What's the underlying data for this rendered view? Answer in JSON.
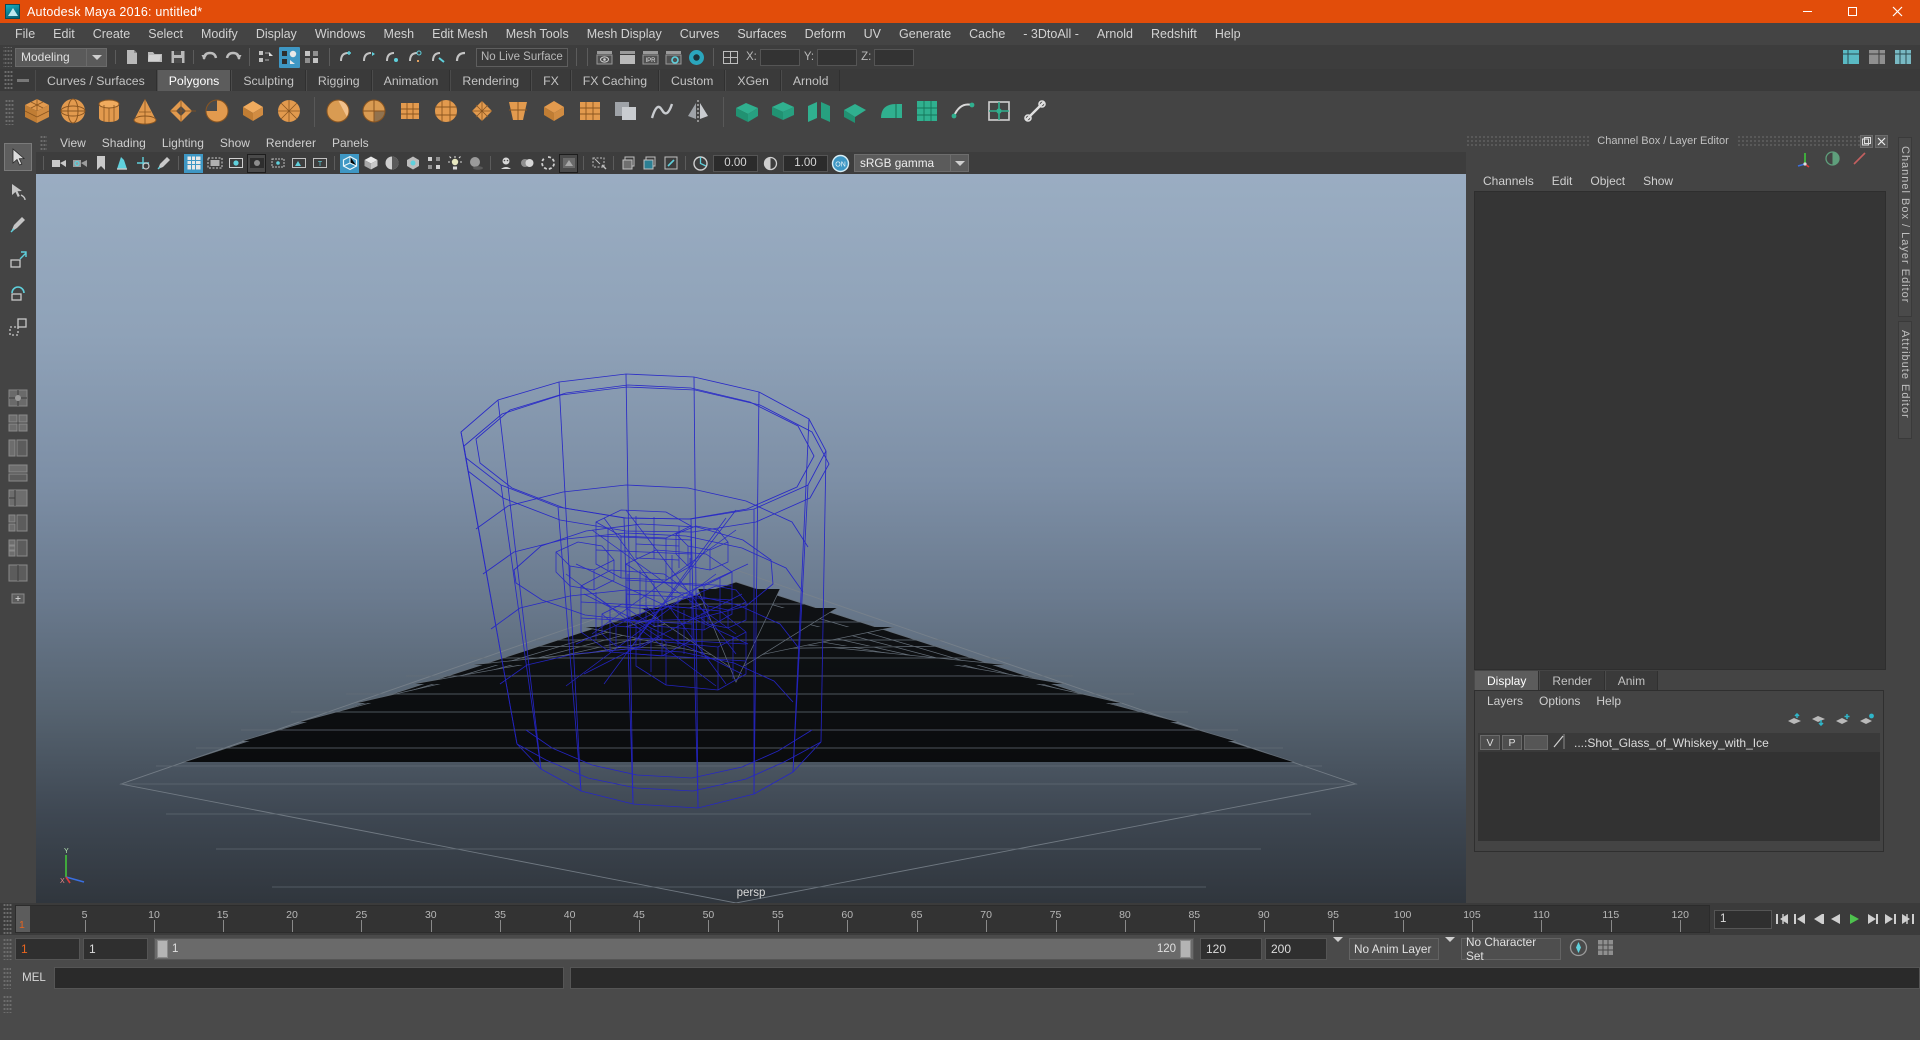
{
  "window": {
    "title": "Autodesk Maya 2016: untitled*",
    "app_icon": "maya-logo-icon",
    "minimize_label": "Minimize",
    "maximize_label": "Maximize",
    "close_label": "Close",
    "accent_color": "#e24d0a"
  },
  "menubar": {
    "items": [
      "File",
      "Edit",
      "Create",
      "Select",
      "Modify",
      "Display",
      "Windows",
      "Mesh",
      "Edit Mesh",
      "Mesh Tools",
      "Mesh Display",
      "Curves",
      "Surfaces",
      "Deform",
      "UV",
      "Generate",
      "Cache",
      "- 3DtoAll -",
      "Arnold",
      "Redshift",
      "Help"
    ]
  },
  "statusline": {
    "mode": "Modeling",
    "live_surface": "No Live Surface",
    "coord_x_label": "X:",
    "coord_y_label": "Y:",
    "coord_z_label": "Z:",
    "coord_x_value": "",
    "coord_y_value": "",
    "coord_z_value": "",
    "icons": [
      "new-scene-icon",
      "open-scene-icon",
      "save-scene-icon",
      "undo-icon",
      "redo-icon",
      "select-by-hierarchy-icon",
      "select-by-object-icon",
      "select-by-component-icon",
      "snap-to-grid-icon",
      "snap-to-curve-icon",
      "snap-to-point-icon",
      "snap-to-projected-center-icon",
      "snap-to-view-plane-icon",
      "make-live-icon",
      "show-render-view-icon",
      "render-current-frame-icon",
      "ipr-render-icon",
      "render-settings-icon",
      "hypershade-icon",
      "editor-layout-icon",
      "show-channel-box-icon",
      "show-attribute-editor-icon",
      "show-tool-settings-icon"
    ]
  },
  "shelf": {
    "tabs": [
      "Curves / Surfaces",
      "Polygons",
      "Sculpting",
      "Rigging",
      "Animation",
      "Rendering",
      "FX",
      "FX Caching",
      "Custom",
      "XGen",
      "Arnold"
    ],
    "active_tab": "Polygons",
    "icons": [
      "poly-cube-icon",
      "poly-sphere-icon",
      "poly-cylinder-icon",
      "poly-cone-icon",
      "poly-torus-icon",
      "poly-plane-icon",
      "poly-disc-icon",
      "poly-platonic-icon",
      "poly-pyramid-icon",
      "poly-prism-icon",
      "poly-pipe-icon",
      "poly-helix-icon",
      "poly-soccer-ball-icon",
      "poly-super-ellipse-icon",
      "combine-icon",
      "separate-icon",
      "booleans-icon",
      "smooth-icon",
      "mirror-geometry-icon",
      "extrude-icon",
      "bevel-icon",
      "bridge-icon",
      "append-polygon-icon",
      "wedge-icon",
      "sculpt-geometry-icon",
      "uv-editor-icon",
      "uv-planar-icon",
      "uv-cylindrical-icon",
      "uv-spherical-icon",
      "uv-automatic-icon",
      "uv-layout-icon",
      "uv-cut-icon"
    ]
  },
  "toolbox": {
    "tools": [
      {
        "name": "select-tool",
        "label": "Select Tool",
        "active": true
      },
      {
        "name": "lasso-select-tool",
        "label": "Lasso Select Tool",
        "active": false
      },
      {
        "name": "paint-select-tool",
        "label": "Paint Selection Tool",
        "active": false
      },
      {
        "name": "move-tool",
        "label": "Move Tool",
        "active": false
      },
      {
        "name": "rotate-tool",
        "label": "Rotate Tool",
        "active": false
      },
      {
        "name": "scale-tool",
        "label": "Scale Tool",
        "active": false
      }
    ],
    "layouts": [
      "single-perspective-layout",
      "four-view-layout",
      "outliner-persp-layout",
      "persp-graph-layout",
      "hypershade-persp-layout",
      "outliner-persp-graph-layout",
      "persp-graph-hypergraph-layout",
      "three-pane-layout",
      "quad-pane-layout"
    ]
  },
  "viewport": {
    "menus": [
      "View",
      "Shading",
      "Lighting",
      "Show",
      "Renderer",
      "Panels"
    ],
    "camera_label": "persp",
    "exposure_value": "0.00",
    "gamma_value": "1.00",
    "color_management": "sRGB gamma",
    "color_management_enabled": "ON",
    "toolbar_icons": [
      "select-camera-icon",
      "camera-attributes-icon",
      "bookmark-icon",
      "image-plane-icon",
      "two-d-pan-zoom-icon",
      "grease-pencil-icon",
      "grid-toggle-icon",
      "film-gate-icon",
      "resolution-gate-icon",
      "gate-mask-icon",
      "film-origin-icon",
      "safe-action-icon",
      "safe-title-icon",
      "wireframe-icon",
      "smooth-shade-icon",
      "shaded-wireframe-icon",
      "textured-icon",
      "use-default-lighting-icon",
      "use-all-lights-icon",
      "shadows-icon",
      "screen-space-ao-icon",
      "motion-blur-icon",
      "multisample-icon",
      "isolate-select-icon",
      "xray-icon",
      "xray-joints-icon",
      "xray-active-components-icon",
      "exposure-icon",
      "gamma-icon",
      "color-management-toggle-icon"
    ],
    "model": {
      "name": "Shot_Glass_of_Whiskey_with_Ice",
      "display_mode": "wireframe",
      "wireframe_color": "#2525c8"
    }
  },
  "right_panel": {
    "title": "Channel Box / Layer Editor",
    "undock_label": "Undock",
    "close_label": "Close",
    "channelbox_menus": [
      "Channels",
      "Edit",
      "Object",
      "Show"
    ],
    "quick_icons": [
      "manipulator-icon",
      "shading-toggle-icon",
      "edit-curve-icon"
    ],
    "layer_tabs": [
      "Display",
      "Render",
      "Anim"
    ],
    "active_layer_tab": "Display",
    "layer_menus": [
      "Layers",
      "Options",
      "Help"
    ],
    "layer_buttons": [
      "move-layer-up-icon",
      "move-layer-down-icon",
      "new-layer-icon",
      "new-layer-from-selected-icon"
    ],
    "layers": [
      {
        "visibility": "V",
        "playback": "P",
        "color_swatch": "",
        "name": "...:Shot_Glass_of_Whiskey_with_Ice"
      }
    ],
    "side_tabs": [
      "Channel Box / Layer Editor",
      "Attribute Editor"
    ]
  },
  "timeline": {
    "current_frame": "1",
    "ticks": [
      5,
      10,
      15,
      20,
      25,
      30,
      35,
      40,
      45,
      50,
      55,
      60,
      65,
      70,
      75,
      80,
      85,
      90,
      95,
      100,
      105,
      110,
      115,
      120
    ],
    "range_start": 1,
    "range_end": 120,
    "frame_field": "1",
    "playback_buttons": [
      "go-to-start-icon",
      "step-back-key-icon",
      "step-back-frame-icon",
      "play-backwards-icon",
      "play-forwards-icon",
      "step-forward-frame-icon",
      "step-forward-key-icon",
      "go-to-end-icon"
    ]
  },
  "range_slider": {
    "anim_start": "1",
    "anim_end": "1",
    "slider_start_label": "1",
    "slider_end_label": "120",
    "playback_end": "120",
    "anim_range_end": "200",
    "anim_layer": "No Anim Layer",
    "character_set": "No Character Set",
    "auto_key_icon": "auto-keyframe-icon",
    "anim_prefs_icon": "animation-preferences-icon"
  },
  "command_line": {
    "language": "MEL",
    "input_value": "",
    "result_value": ""
  }
}
